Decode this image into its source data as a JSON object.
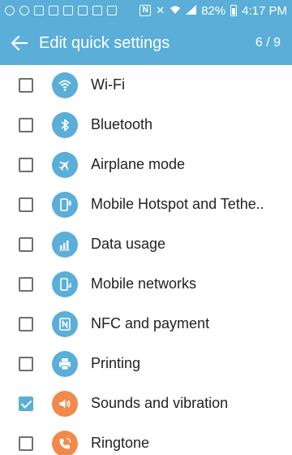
{
  "status_bar": {
    "battery_percent": "82%",
    "time": "4:17 PM",
    "nfc_label": "N"
  },
  "header": {
    "title": "Edit quick settings",
    "page_counter": "6 / 9",
    "back_icon": "arrow-left-icon"
  },
  "colors": {
    "accent": "#5aaed8",
    "orange": "#f08a4b"
  },
  "items": [
    {
      "label": "Wi-Fi",
      "checked": false,
      "icon": "wifi-icon",
      "color": "blue"
    },
    {
      "label": "Bluetooth",
      "checked": false,
      "icon": "bluetooth-icon",
      "color": "blue"
    },
    {
      "label": "Airplane mode",
      "checked": false,
      "icon": "airplane-icon",
      "color": "blue"
    },
    {
      "label": "Mobile Hotspot and Tethe..",
      "checked": false,
      "icon": "hotspot-icon",
      "color": "blue"
    },
    {
      "label": "Data usage",
      "checked": false,
      "icon": "data-usage-icon",
      "color": "blue"
    },
    {
      "label": "Mobile networks",
      "checked": false,
      "icon": "mobile-networks-icon",
      "color": "blue"
    },
    {
      "label": "NFC and payment",
      "checked": false,
      "icon": "nfc-icon",
      "color": "blue"
    },
    {
      "label": "Printing",
      "checked": false,
      "icon": "printer-icon",
      "color": "blue"
    },
    {
      "label": "Sounds and vibration",
      "checked": true,
      "icon": "volume-icon",
      "color": "orange"
    },
    {
      "label": "Ringtone",
      "checked": false,
      "icon": "phone-ringtone-icon",
      "color": "orange"
    }
  ]
}
